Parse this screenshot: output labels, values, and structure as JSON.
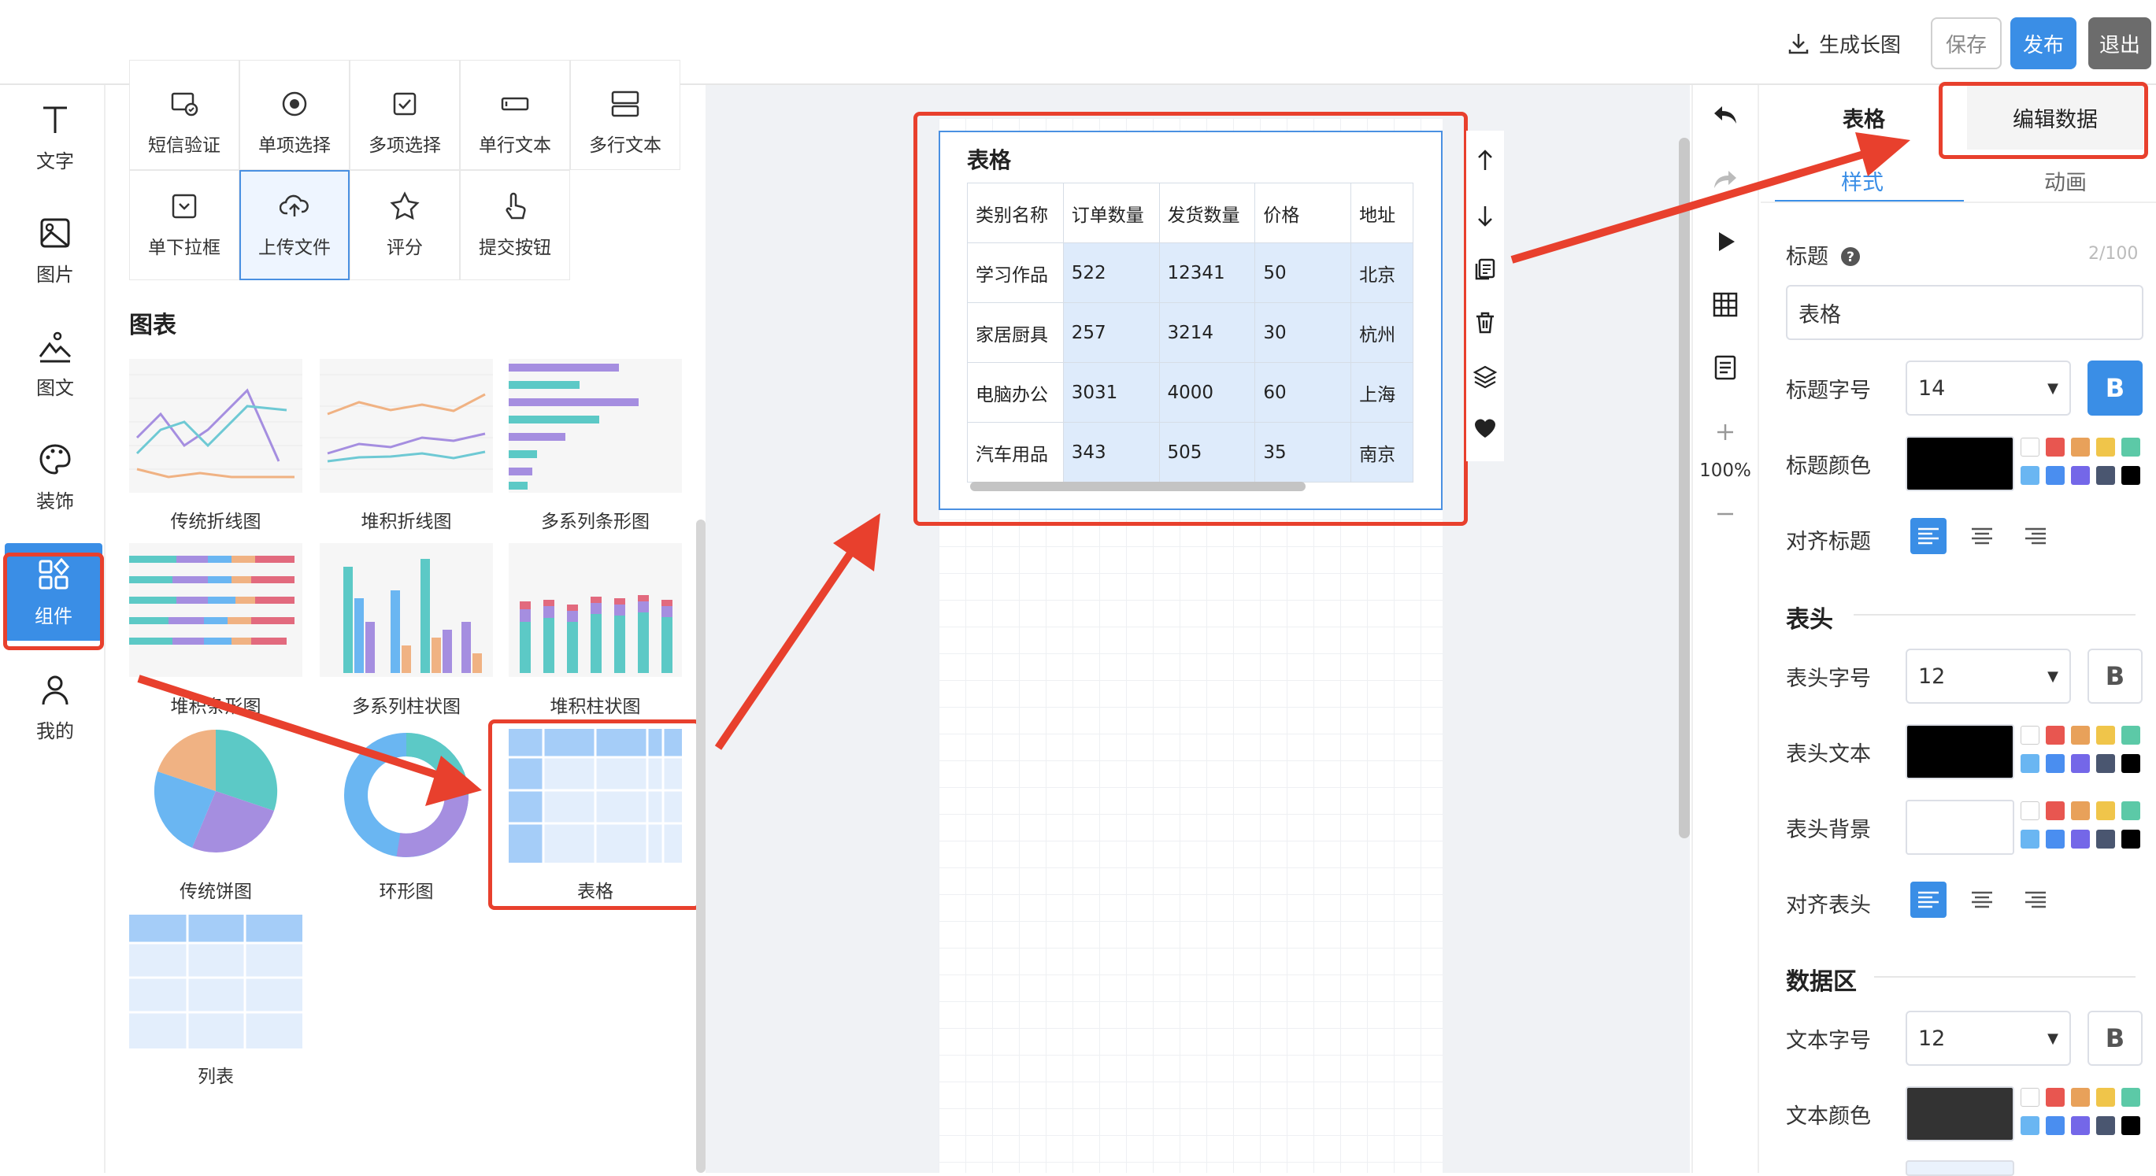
{
  "topbar": {
    "generate_long_image": "生成长图",
    "save": "保存",
    "publish": "发布",
    "exit": "退出",
    "accent": "#3a8ee6"
  },
  "leftnav": {
    "items": [
      {
        "label": "文字",
        "icon": "text-icon"
      },
      {
        "label": "图片",
        "icon": "image-icon"
      },
      {
        "label": "图文",
        "icon": "image-text-icon"
      },
      {
        "label": "装饰",
        "icon": "palette-icon"
      },
      {
        "label": "组件",
        "icon": "components-icon",
        "active": true
      },
      {
        "label": "我的",
        "icon": "user-icon"
      }
    ]
  },
  "panel": {
    "form_row1": [
      "短信验证",
      "单项选择",
      "多项选择",
      "单行文本",
      "多行文本"
    ],
    "form_row2": [
      "单下拉框",
      "上传文件",
      "评分",
      "提交按钮"
    ],
    "charts_title": "图表",
    "charts": [
      "传统折线图",
      "堆积折线图",
      "多系列条形图",
      "堆积条形图",
      "多系列柱状图",
      "堆积柱状图",
      "传统饼图",
      "环形图",
      "表格",
      "列表"
    ]
  },
  "widget": {
    "title": "表格",
    "headers": [
      "类别名称",
      "订单数量",
      "发货数量",
      "价格",
      "地址"
    ],
    "rows": [
      [
        "学习作品",
        "522",
        "12341",
        "50",
        "北京"
      ],
      [
        "家居厨具",
        "257",
        "3214",
        "30",
        "杭州"
      ],
      [
        "电脑办公",
        "3031",
        "4000",
        "60",
        "上海"
      ],
      [
        "汽车用品",
        "343",
        "505",
        "35",
        "南京"
      ]
    ]
  },
  "zoom": "100%",
  "props": {
    "title_tab": "表格",
    "edit_data": "编辑数据",
    "tab_style": "样式",
    "tab_animation": "动画",
    "title_label": "标题",
    "title_count": "2/100",
    "title_value": "表格",
    "title_size_label": "标题字号",
    "title_size": "14",
    "title_color_label": "标题颜色",
    "title_align_label": "对齐标题",
    "header_section": "表头",
    "header_size_label": "表头字号",
    "header_size": "12",
    "header_text_label": "表头文本",
    "header_bg_label": "表头背景",
    "header_align_label": "对齐表头",
    "data_section": "数据区",
    "text_size_label": "文本字号",
    "text_size": "12",
    "text_color_label": "文本颜色",
    "bold_glyph": "B"
  },
  "palette": [
    "#ffffff",
    "#e85650",
    "#e8a15a",
    "#f0c54a",
    "#5cc9a7",
    "#6ab6f2",
    "#4a8ef0",
    "#7467e8",
    "#4a5670",
    "#000000"
  ]
}
